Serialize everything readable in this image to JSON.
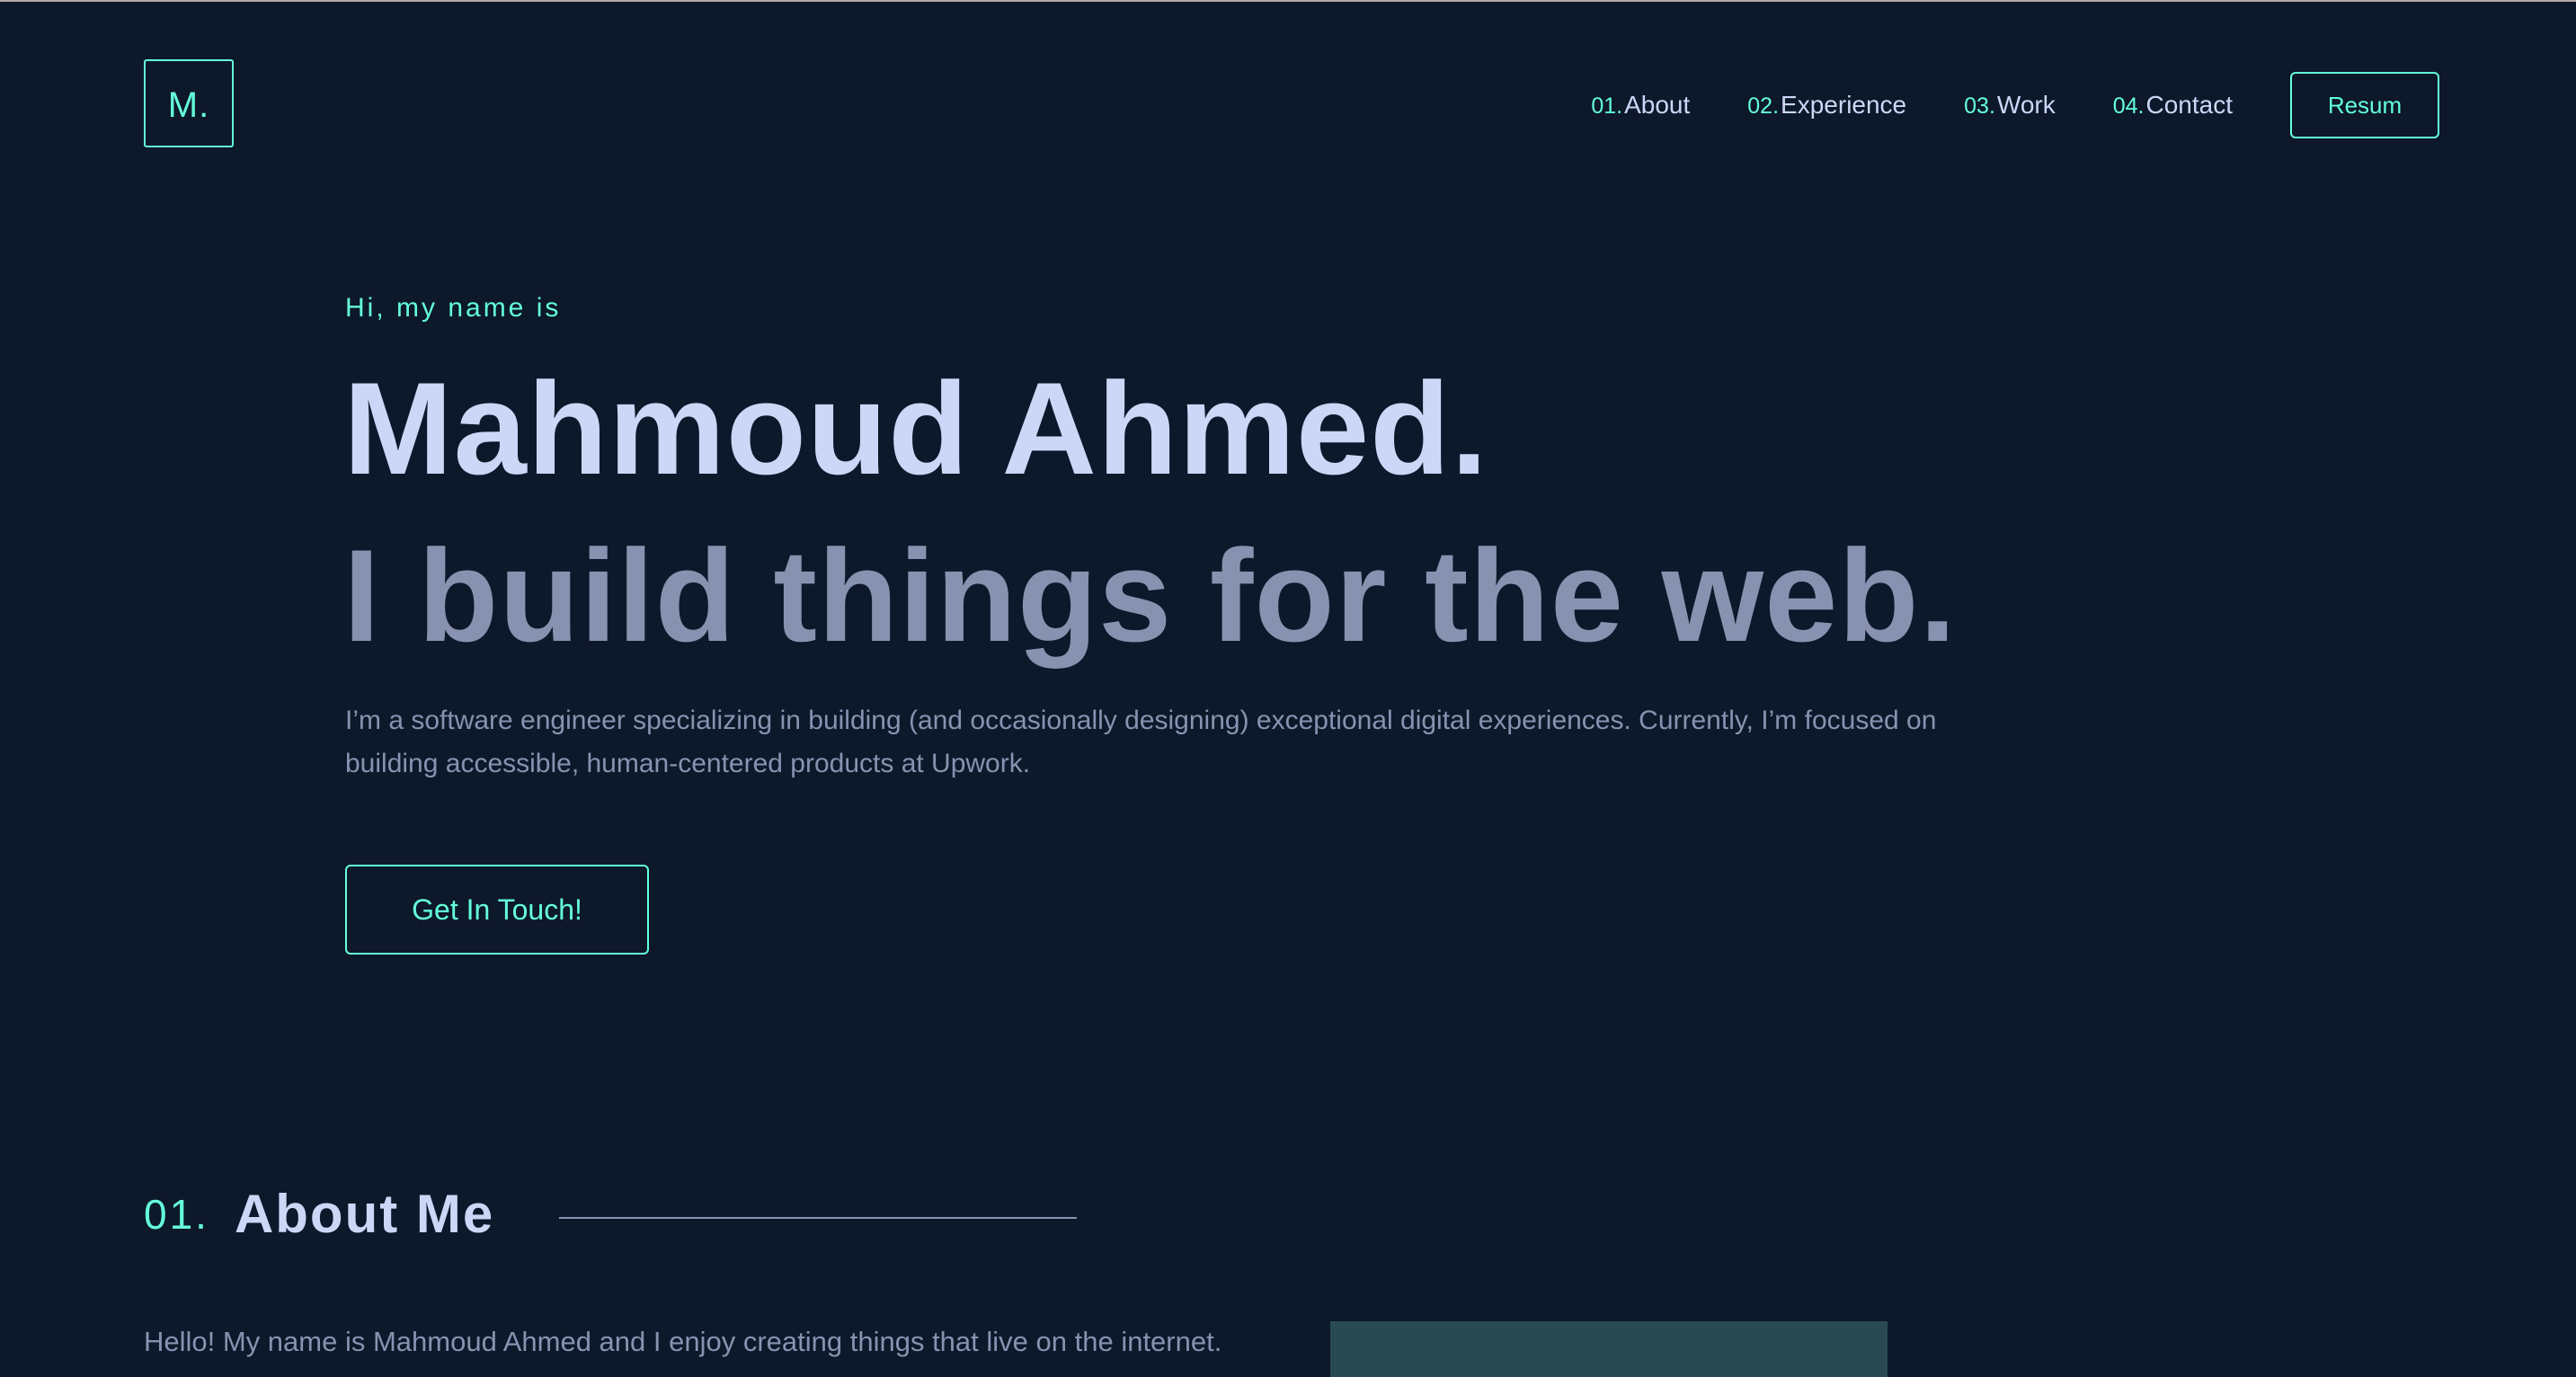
{
  "logo": {
    "text": "M."
  },
  "nav": {
    "items": [
      {
        "num": "01.",
        "label": "About"
      },
      {
        "num": "02.",
        "label": "Experience"
      },
      {
        "num": "03.",
        "label": "Work"
      },
      {
        "num": "04.",
        "label": "Contact"
      }
    ],
    "resume_label": "Resum"
  },
  "hero": {
    "intro": "Hi, my name is",
    "name": "Mahmoud Ahmed.",
    "tagline": "I build things for the web.",
    "description": "I’m a software engineer specializing in building (and occasionally designing) exceptional digital experiences. Currently, I’m focused on building accessible, human-centered products at Upwork.",
    "cta_label": "Get In Touch!"
  },
  "about": {
    "num": "01.",
    "title": "About Me",
    "paragraph": "Hello! My name is Mahmoud Ahmed and I enjoy creating things that live on the internet."
  },
  "colors": {
    "background": "#0d182b",
    "accent": "#64ffda",
    "heading": "#ccd6f6",
    "muted": "#8892b0"
  }
}
